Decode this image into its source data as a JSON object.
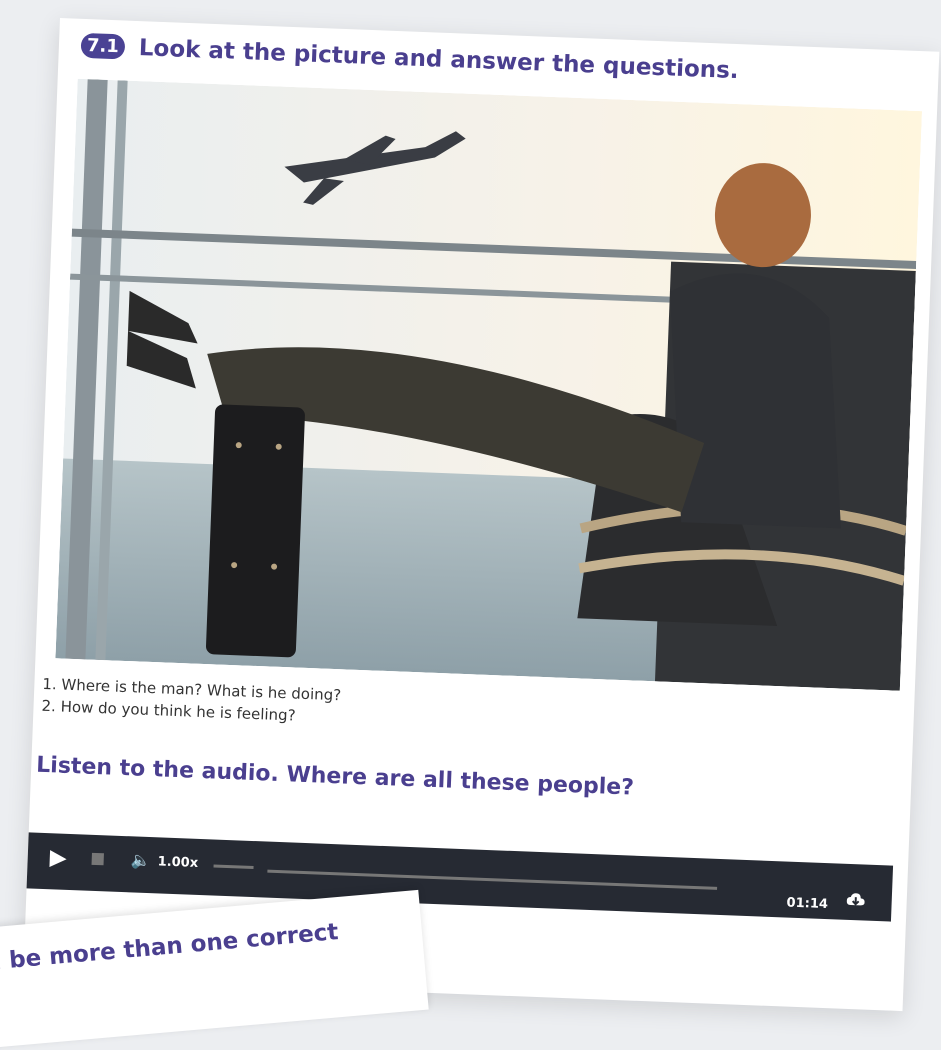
{
  "exercise": {
    "badge": "7.1",
    "title": "Look at the picture and answer the questions."
  },
  "questions": [
    "1. Where is the man? What is he doing?",
    "2. How do you think he is feeling?"
  ],
  "listen": {
    "heading": "Listen to the audio. Where are all these people?"
  },
  "player": {
    "speed": "1.00x",
    "time": "01:14"
  },
  "next_card": {
    "text": "n be more than one correct"
  }
}
